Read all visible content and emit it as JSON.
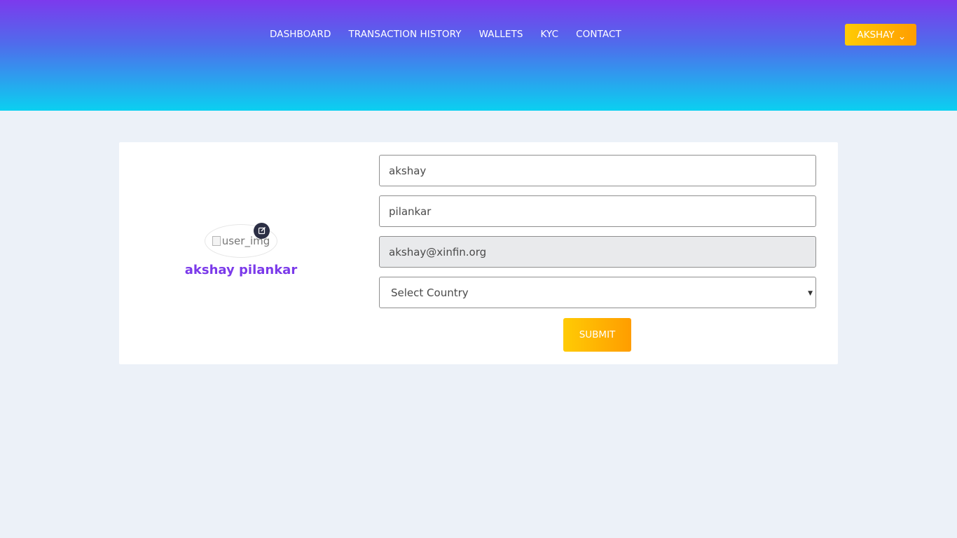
{
  "nav": {
    "items": [
      {
        "label": "DASHBOARD"
      },
      {
        "label": "TRANSACTION HISTORY"
      },
      {
        "label": "WALLETS"
      },
      {
        "label": "KYC"
      },
      {
        "label": "CONTACT"
      }
    ],
    "user_menu_label": "AKSHAY"
  },
  "profile": {
    "avatar_alt": "user_img",
    "display_name": "akshay pilankar"
  },
  "form": {
    "first_name": "akshay",
    "last_name": "pilankar",
    "email": "akshay@xinfin.org",
    "country_selected": "Select Country",
    "submit_label": "SUBMIT"
  },
  "colors": {
    "header_gradient_top": "#7c3aed",
    "header_gradient_bottom": "#0bd0f0",
    "accent_orange": "#ff9d00",
    "accent_yellow": "#ffcb05",
    "name_purple": "#7b3aea",
    "page_bg": "#ecf1f8"
  },
  "icons": {
    "user_menu": "chevron-down-icon",
    "avatar_edit": "edit-icon",
    "select": "caret-down-icon"
  }
}
